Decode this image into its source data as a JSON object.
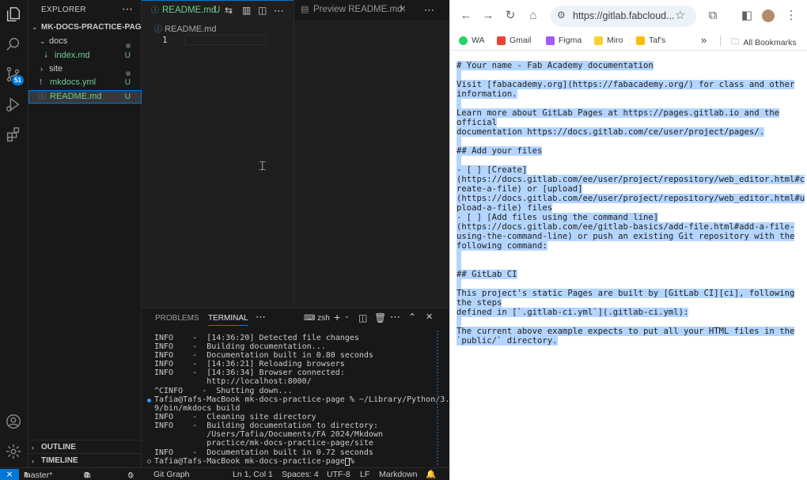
{
  "vscode": {
    "activity_badge": "51",
    "explorer": {
      "title": "EXPLORER",
      "project": "MK-DOCS-PRACTICE-PAGE",
      "items": [
        {
          "label": "docs",
          "status": "",
          "kind": "folder-open"
        },
        {
          "label": "index.md",
          "status": "U",
          "kind": "file-md"
        },
        {
          "label": "site",
          "status": "",
          "kind": "folder"
        },
        {
          "label": "mkdocs.yml",
          "status": "U",
          "kind": "file-yml"
        },
        {
          "label": "README.md",
          "status": "U",
          "kind": "file-info"
        }
      ],
      "outline": "OUTLINE",
      "timeline": "TIMELINE"
    },
    "tabs": [
      {
        "label": "README.md",
        "status": "U"
      },
      {
        "label": "Preview README.md"
      }
    ],
    "breadcrumb": "README.md",
    "line_number": "1",
    "panel": {
      "tabs": [
        "PROBLEMS",
        "TERMINAL"
      ],
      "shell": "zsh",
      "lines": [
        "INFO    -  [14:36:20] Detected file changes",
        "INFO    -  Building documentation...",
        "INFO    -  Documentation built in 0.80 seconds",
        "INFO    -  [14:36:21] Reloading browsers",
        "INFO    -  [14:36:34] Browser connected:",
        "           http://localhost:8000/",
        "^CINFO    -  Shutting down...",
        "Tafia@Tafs-MacBook mk-docs-practice-page % ~/Library/Python/3.",
        "9/bin/mkdocs build",
        "INFO    -  Cleaning site directory",
        "INFO    -  Building documentation to directory:",
        "           /Users/Tafia/Documents/FA 2024/Mkdown",
        "           practice/mk-docs-practice-page/site",
        "INFO    -  Documentation built in 0.72 seconds",
        "Tafia@Tafs-MacBook mk-docs-practice-page % "
      ]
    },
    "status": {
      "branch": "master*",
      "errors": "0",
      "warnings": "0",
      "ports": "0",
      "git_graph": "Git Graph",
      "position": "Ln 1, Col 1",
      "spaces": "Spaces: 4",
      "encoding": "UTF-8",
      "eol": "LF",
      "language": "Markdown"
    }
  },
  "chrome": {
    "url": "https://gitlab.fabcloud...",
    "bookmarks": [
      {
        "label": "WA",
        "color": "#25d366"
      },
      {
        "label": "Gmail",
        "color": "#ea4335"
      },
      {
        "label": "Figma",
        "color": "#a259ff"
      },
      {
        "label": "Miro",
        "color": "#050038"
      },
      {
        "label": "Taf's",
        "color": "#fbbc04"
      }
    ],
    "all_bookmarks": "All Bookmarks",
    "content_lines": [
      "# Your name - Fab Academy documentation",
      "",
      "Visit [fabacademy.org](https://fabacademy.org/) for class and other",
      "information.",
      "",
      "Learn more about GitLab Pages at https://pages.gitlab.io and the",
      "official",
      "documentation https://docs.gitlab.com/ce/user/project/pages/.",
      "",
      "## Add your files",
      "",
      "- [ ] [Create]",
      "(https://docs.gitlab.com/ee/user/project/repository/web_editor.html#c",
      "reate-a-file) or [upload]",
      "(https://docs.gitlab.com/ee/user/project/repository/web_editor.html#u",
      "pload-a-file) files",
      "- [ ] [Add files using the command line]",
      "(https://docs.gitlab.com/ee/gitlab-basics/add-file.html#add-a-file-",
      "using-the-command-line) or push an existing Git repository with the",
      "following command:",
      "",
      "",
      "## GitLab CI",
      "",
      "This project's static Pages are built by [GitLab CI][ci], following",
      "the steps",
      "defined in [`.gitlab-ci.yml`](.gitlab-ci.yml):",
      "",
      "The current above example expects to put all your HTML files in the",
      "`public/` directory."
    ]
  }
}
